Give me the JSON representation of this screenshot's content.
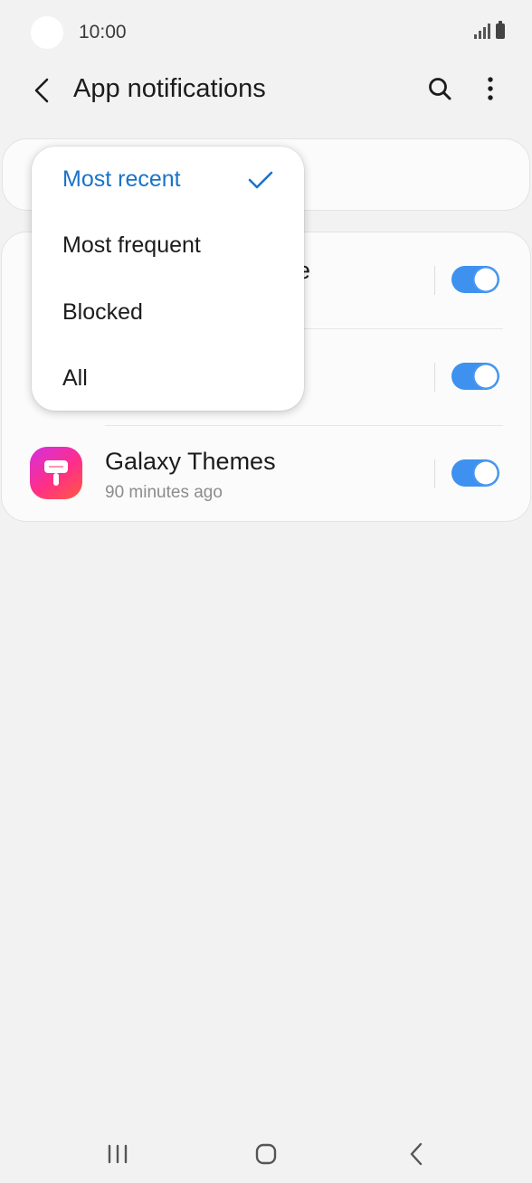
{
  "status_bar": {
    "time": "10:00"
  },
  "app_bar": {
    "title": "App notifications"
  },
  "sort_dropdown": {
    "options": [
      {
        "label": "Most recent",
        "selected": true
      },
      {
        "label": "Most frequent",
        "selected": false
      },
      {
        "label": "Blocked",
        "selected": false
      },
      {
        "label": "All",
        "selected": false
      }
    ]
  },
  "apps": [
    {
      "name": "e",
      "time": "",
      "enabled": true
    },
    {
      "name": "",
      "time": "",
      "enabled": true
    },
    {
      "name": "Galaxy Themes",
      "time": "90 minutes ago",
      "enabled": true
    }
  ],
  "colors": {
    "accent": "#3e91ee",
    "selected_text": "#1a73c8",
    "background": "#f2f2f2"
  }
}
